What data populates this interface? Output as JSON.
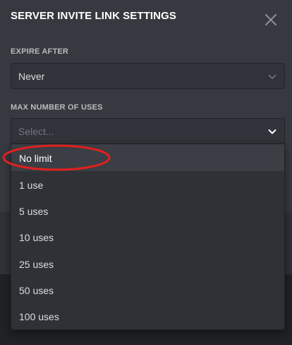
{
  "modal": {
    "title": "SERVER INVITE LINK SETTINGS",
    "close_icon": "close-icon"
  },
  "expire": {
    "label": "EXPIRE AFTER",
    "value": "Never",
    "icon": "chevron-down-icon"
  },
  "max_uses": {
    "label": "MAX NUMBER OF USES",
    "placeholder": "Select...",
    "icon": "chevron-down-icon",
    "options": [
      "No limit",
      "1 use",
      "5 uses",
      "10 uses",
      "25 uses",
      "50 uses",
      "100 uses"
    ],
    "hovered_option": "No limit"
  },
  "annotation": {
    "color": "#e0201c",
    "shape": "ellipse"
  },
  "colors": {
    "background": "#36393f",
    "dropdown": "#2f3136",
    "hover": "#3b3e44",
    "text": "#dcddde",
    "label": "#b9bbbe"
  }
}
